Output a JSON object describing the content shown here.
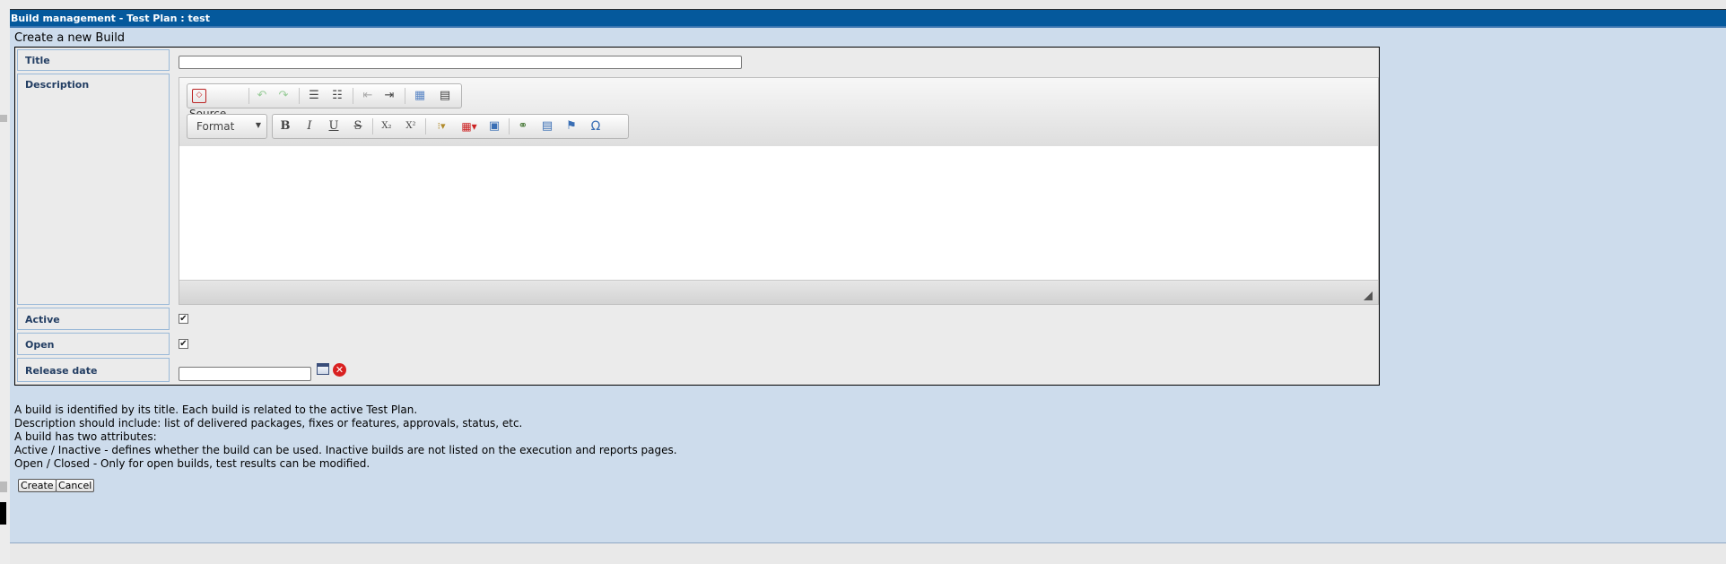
{
  "window": {
    "title": "Build management - Test Plan : test"
  },
  "form": {
    "heading": "Create a new Build",
    "labels": {
      "title": "Title",
      "description": "Description",
      "active": "Active",
      "open": "Open",
      "release_date": "Release date"
    },
    "values": {
      "title": "",
      "release_date": "",
      "active_checked": true,
      "open_checked": true
    }
  },
  "editor": {
    "source_label": "Source",
    "format_label": "Format",
    "toolbar_icons": [
      "source-icon",
      "undo-icon",
      "redo-icon",
      "numbered-list-icon",
      "bulleted-list-icon",
      "outdent-icon",
      "indent-icon",
      "table-icon",
      "horizontal-rule-icon",
      "bold-icon",
      "italic-icon",
      "underline-icon",
      "strike-icon",
      "subscript-icon",
      "superscript-icon",
      "list-style-icon",
      "table-insert-icon",
      "image-icon",
      "link-icon",
      "image-upload-icon",
      "flag-icon",
      "special-char-icon"
    ],
    "glyphs": {
      "bold": "B",
      "italic": "I",
      "underline": "U",
      "strike": "S",
      "subscript": "X₂",
      "superscript": "X²",
      "omega": "Ω"
    }
  },
  "help": {
    "lines": [
      "A build is identified by its title. Each build is related to the active Test Plan.",
      "Description should include: list of delivered packages, fixes or features, approvals, status, etc.",
      "A build has two attributes:",
      "Active / Inactive - defines whether the build can be used. Inactive builds are not listed on the execution and reports pages.",
      "Open / Closed - Only for open builds, test results can be modified."
    ]
  },
  "buttons": {
    "create": "Create",
    "cancel": "Cancel"
  },
  "colors": {
    "titlebar": "#05599c",
    "page_bg": "#cddcec",
    "label_text": "#233e63"
  }
}
